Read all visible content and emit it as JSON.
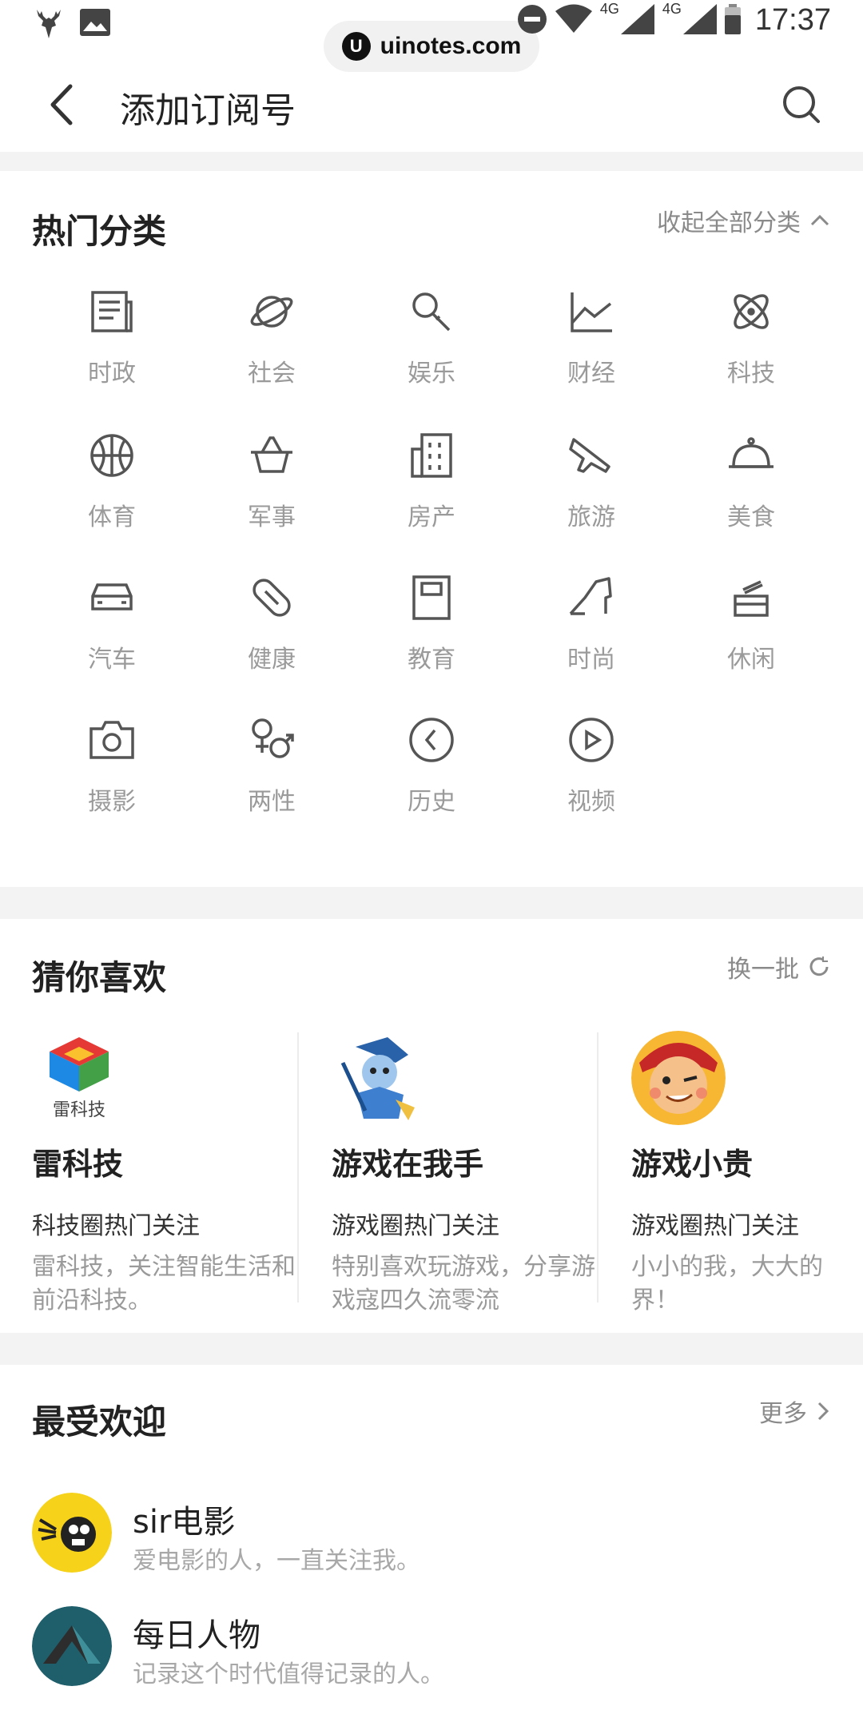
{
  "status_bar": {
    "time": "17:37",
    "network_1": "4G",
    "network_2": "4G",
    "icons": [
      "deer-icon",
      "image-icon",
      "dnd-icon",
      "wifi-icon",
      "signal-icon",
      "signal-icon",
      "battery-icon"
    ]
  },
  "watermark": {
    "text": "uinotes.com"
  },
  "header": {
    "title": "添加订阅号"
  },
  "hot_categories": {
    "title": "热门分类",
    "toggle_label": "收起全部分类",
    "items": [
      {
        "label": "时政",
        "icon": "newspaper-icon"
      },
      {
        "label": "社会",
        "icon": "planet-icon"
      },
      {
        "label": "娱乐",
        "icon": "microphone-icon"
      },
      {
        "label": "财经",
        "icon": "line-chart-icon"
      },
      {
        "label": "科技",
        "icon": "atom-icon"
      },
      {
        "label": "体育",
        "icon": "basketball-icon"
      },
      {
        "label": "军事",
        "icon": "basket-icon"
      },
      {
        "label": "房产",
        "icon": "building-icon"
      },
      {
        "label": "旅游",
        "icon": "airplane-icon"
      },
      {
        "label": "美食",
        "icon": "cloche-icon"
      },
      {
        "label": "汽车",
        "icon": "car-icon"
      },
      {
        "label": "健康",
        "icon": "pill-icon"
      },
      {
        "label": "教育",
        "icon": "book-icon"
      },
      {
        "label": "时尚",
        "icon": "high-heel-icon"
      },
      {
        "label": "休闲",
        "icon": "teacup-icon"
      },
      {
        "label": "摄影",
        "icon": "camera-icon"
      },
      {
        "label": "两性",
        "icon": "gender-icon"
      },
      {
        "label": "历史",
        "icon": "clock-icon"
      },
      {
        "label": "视频",
        "icon": "play-icon"
      }
    ]
  },
  "recommend": {
    "title": "猜你喜欢",
    "refresh_label": "换一批",
    "items": [
      {
        "name": "雷科技",
        "logo_text": "雷科技",
        "tag": "科技圈热门关注",
        "desc": "雷科技，关注智能生活和前沿科技。"
      },
      {
        "name": "游戏在我手",
        "tag": "游戏圈热门关注",
        "desc": "特别喜欢玩游戏，分享游戏寇四久流零流"
      },
      {
        "name": "游戏小贵",
        "tag": "游戏圈热门关注",
        "desc": "小小的我，大大的界！"
      }
    ]
  },
  "popular": {
    "title": "最受欢迎",
    "more_label": "更多",
    "items": [
      {
        "name": "sir电影",
        "desc": "爱电影的人，一直关注我。"
      },
      {
        "name": "每日人物",
        "desc": "记录这个时代值得记录的人。"
      }
    ]
  },
  "colors": {
    "icon_stroke": "#555555",
    "label_gray": "#9a9a9a",
    "divider": "#f3f3f3"
  }
}
